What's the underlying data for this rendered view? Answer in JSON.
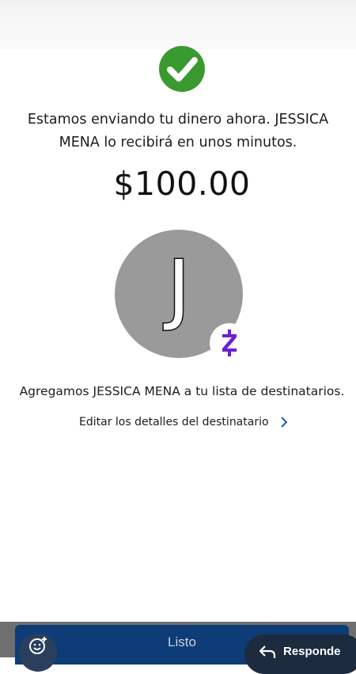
{
  "confirmation": {
    "message": "Estamos enviando tu dinero ahora. JESSICA MENA lo recibirá en unos minutos.",
    "amount": "$100.00"
  },
  "recipient": {
    "avatar_initial": "J",
    "avatar_color": "#9a9a9a",
    "badge_icon": "zelle-logo-icon",
    "badge_color": "#6d1ed4",
    "added_message": "Agregamos JESSICA MENA a tu lista de destinatarios.",
    "edit_link_label": "Editar los detalles del destinatario"
  },
  "footer": {
    "done_label": "Listo",
    "reply_label": "Responde",
    "done_color": "#0e3c77"
  },
  "colors": {
    "success": "#3a9a2f",
    "link_chevron": "#1a5fb4"
  }
}
